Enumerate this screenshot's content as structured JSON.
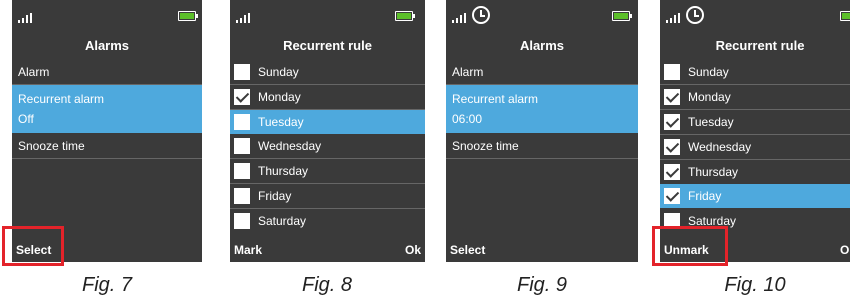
{
  "screens": [
    {
      "title": "Alarms",
      "items": [
        {
          "label": "Alarm"
        },
        {
          "label": "Recurrent alarm",
          "value": "Off",
          "selected": true
        },
        {
          "label": "Snooze time"
        }
      ],
      "softkeys": {
        "left": "Select",
        "right": ""
      },
      "show_clock": false,
      "highlight_left_softkey": true,
      "caption": "Fig. 7"
    },
    {
      "title": "Recurrent rule",
      "days": [
        {
          "label": "Sunday",
          "checked": false,
          "selected": false
        },
        {
          "label": "Monday",
          "checked": true,
          "selected": false
        },
        {
          "label": "Tuesday",
          "checked": false,
          "selected": true
        },
        {
          "label": "Wednesday",
          "checked": false,
          "selected": false
        },
        {
          "label": "Thursday",
          "checked": false,
          "selected": false
        },
        {
          "label": "Friday",
          "checked": false,
          "selected": false
        },
        {
          "label": "Saturday",
          "checked": false,
          "selected": false
        }
      ],
      "softkeys": {
        "left": "Mark",
        "right": "Ok"
      },
      "show_clock": false,
      "caption": "Fig. 8"
    },
    {
      "title": "Alarms",
      "items": [
        {
          "label": "Alarm"
        },
        {
          "label": "Recurrent alarm",
          "value": "06:00",
          "selected": true
        },
        {
          "label": "Snooze time"
        }
      ],
      "softkeys": {
        "left": "Select",
        "right": ""
      },
      "show_clock": true,
      "caption": "Fig. 9"
    },
    {
      "title": "Recurrent rule",
      "days": [
        {
          "label": "Sunday",
          "checked": false,
          "selected": false
        },
        {
          "label": "Monday",
          "checked": true,
          "selected": false
        },
        {
          "label": "Tuesday",
          "checked": true,
          "selected": false
        },
        {
          "label": "Wednesday",
          "checked": true,
          "selected": false
        },
        {
          "label": "Thursday",
          "checked": true,
          "selected": false
        },
        {
          "label": "Friday",
          "checked": true,
          "selected": true
        },
        {
          "label": "Saturday",
          "checked": false,
          "selected": false
        }
      ],
      "softkeys": {
        "left": "Unmark",
        "right": "Ok"
      },
      "show_clock": true,
      "highlight_left_softkey": true,
      "caption": "Fig. 10"
    }
  ],
  "colors": {
    "screen_bg": "#3a3a3a",
    "selection": "#4ea9dd",
    "battery": "#5cbf2a",
    "highlight": "#e3232a"
  }
}
